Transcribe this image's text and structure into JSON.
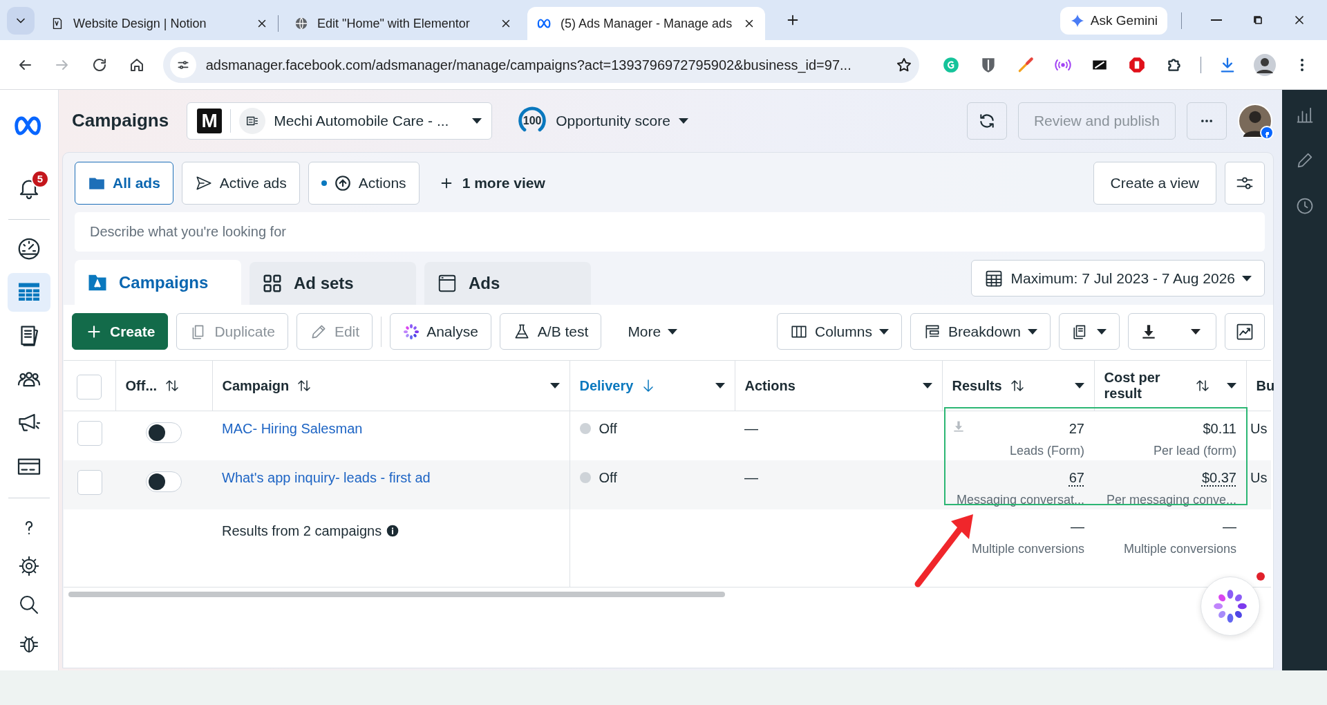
{
  "browser": {
    "tabs": [
      {
        "title": "Website Design | Notion",
        "selected": false
      },
      {
        "title": "Edit \"Home\" with Elementor",
        "selected": false
      },
      {
        "title": "(5) Ads Manager - Manage ads",
        "selected": true
      }
    ],
    "ask_gemini": "Ask Gemini",
    "address": "adsmanager.facebook.com/adsmanager/manage/campaigns?act=1393796972795902&business_id=97..."
  },
  "left_nav": {
    "notification_count": "5",
    "primary_items": [
      {
        "selected": false
      },
      {
        "selected": true
      },
      {
        "selected": false
      },
      {
        "selected": false
      },
      {
        "selected": false
      },
      {
        "selected": false
      }
    ],
    "secondary_items": [
      {
        "selected": false
      },
      {
        "selected": false
      },
      {
        "selected": false
      },
      {
        "selected": false
      }
    ]
  },
  "header": {
    "title": "Campaigns",
    "account_logo": "M",
    "account_name": "Mechi Automobile Care - ...",
    "opportunity_score": "100",
    "opportunity_label": "Opportunity score",
    "publish_button": {
      "label": "Review and publish",
      "disabled": true
    }
  },
  "views": [
    {
      "label": "All ads",
      "selected": true,
      "unread": false
    },
    {
      "label": "Active ads",
      "selected": false,
      "unread": false
    },
    {
      "label": "Actions",
      "selected": false,
      "unread": true
    }
  ],
  "more_views": "1 more view",
  "create_view": "Create a view",
  "search": {
    "placeholder": "Describe what you're looking for"
  },
  "level_tabs": [
    {
      "label": "Campaigns",
      "selected": true
    },
    {
      "label": "Ad sets",
      "selected": false
    },
    {
      "label": "Ads",
      "selected": false
    }
  ],
  "date_range": "Maximum: 7 Jul 2023 - 7 Aug 2026",
  "toolbar": [
    {
      "label": "Create",
      "kind": "primary",
      "disabled": false
    },
    {
      "label": "Duplicate",
      "kind": "duplicate",
      "disabled": true
    },
    {
      "label": "Edit",
      "kind": "edit",
      "disabled": true
    },
    {
      "label": "Analyse",
      "kind": "analyse",
      "disabled": false
    },
    {
      "label": "A/B test",
      "kind": "abtest",
      "disabled": false
    },
    {
      "label": "More",
      "kind": "menu",
      "disabled": false
    }
  ],
  "view_tools": [
    {
      "label": "Columns",
      "kind": "columns"
    },
    {
      "label": "Breakdown",
      "kind": "breakdown"
    }
  ],
  "table": {
    "all_selected": false,
    "columns": [
      {
        "label": "Off...",
        "sortable": true,
        "menu": false,
        "sorted": false
      },
      {
        "label": "Campaign",
        "sortable": true,
        "menu": true,
        "sorted": false
      },
      {
        "label": "Delivery",
        "sortable": true,
        "menu": true,
        "sorted": true
      },
      {
        "label": "Actions",
        "sortable": false,
        "menu": true,
        "sorted": false
      },
      {
        "label": "Results",
        "sortable": true,
        "menu": true,
        "sorted": false
      },
      {
        "label": "Cost per result",
        "sortable": true,
        "menu": true,
        "sorted": false
      },
      {
        "label": "Bu",
        "sortable": false,
        "menu": false,
        "sorted": false
      }
    ],
    "rows": [
      {
        "selected": false,
        "on": false,
        "hovered": false,
        "campaign": "MAC- Hiring Salesman",
        "delivery": "Off",
        "actions": "—",
        "results": "27",
        "results_note": "Leads (Form)",
        "cost": "$0.11",
        "cost_note": "Per lead (form)",
        "column_7": "Us",
        "download_icon": true,
        "underlined": false
      },
      {
        "selected": false,
        "on": false,
        "hovered": true,
        "campaign": "What's app inquiry- leads - first ad",
        "delivery": "Off",
        "actions": "—",
        "results": "67",
        "results_note": "Messaging conversat...",
        "cost": "$0.37",
        "cost_note": "Per messaging conve...",
        "column_7": "Us",
        "download_icon": false,
        "underlined": true
      }
    ],
    "summary": {
      "label": "Results from 2 campaigns",
      "results": "—",
      "results_note": "Multiple conversions",
      "cost": "—",
      "cost_note": "Multiple conversions"
    }
  }
}
